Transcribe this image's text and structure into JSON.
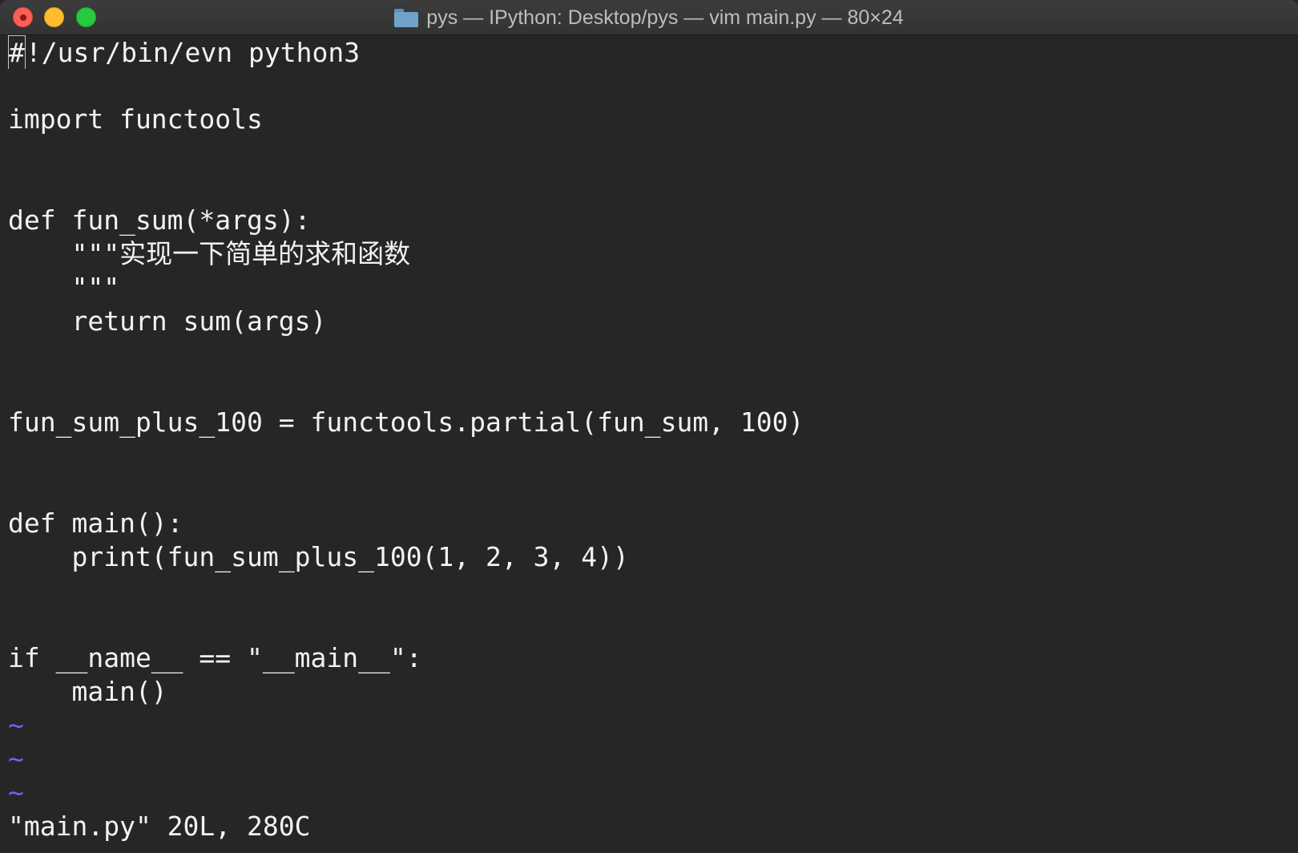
{
  "window": {
    "title": "pys — IPython: Desktop/pys — vim main.py — 80×24",
    "folder_icon": "folder-icon"
  },
  "editor": {
    "lines": [
      "#!/usr/bin/evn python3",
      "",
      "import functools",
      "",
      "",
      "def fun_sum(*args):",
      "    \"\"\"实现一下简单的求和函数",
      "    \"\"\"",
      "    return sum(args)",
      "",
      "",
      "fun_sum_plus_100 = functools.partial(fun_sum, 100)",
      "",
      "",
      "def main():",
      "    print(fun_sum_plus_100(1, 2, 3, 4))",
      "",
      "",
      "if __name__ == \"__main__\":",
      "    main()"
    ],
    "tildes": [
      "~",
      "~",
      "~"
    ],
    "cursor_char": "#",
    "first_line_rest": "!/usr/bin/evn python3"
  },
  "status": {
    "message": "\"main.py\" 20L, 280C"
  },
  "colors": {
    "background": "#262626",
    "text": "#f2f2f2",
    "tilde": "#6c63ff"
  }
}
